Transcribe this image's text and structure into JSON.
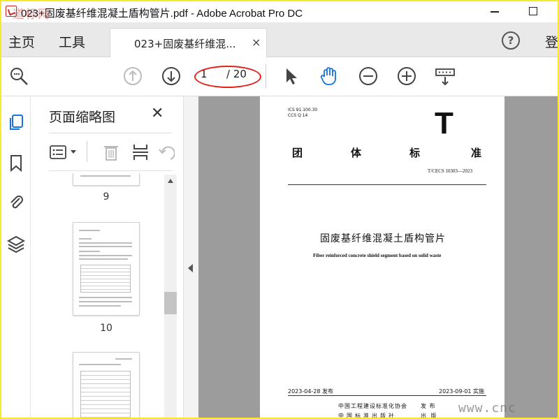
{
  "window": {
    "title": "023+固废基纤维混凝土盾构管片.pdf - Adobe Acrobat Pro DC",
    "watermark_top": "道标网"
  },
  "menu": {
    "home": "主页",
    "tools": "工具",
    "doc_tab": "023+固废基纤维混...",
    "close_tab": "×",
    "help": "?",
    "signin": "登"
  },
  "toolbar": {
    "current_page": "1",
    "page_total": "/ 20"
  },
  "thumbnail_panel": {
    "title": "页面缩略图",
    "close": "✕",
    "pages": [
      "9",
      "10"
    ]
  },
  "document": {
    "ics": "ICS 91.100.30",
    "ccs": "CCS Q 14",
    "big_letter": "T",
    "standard_type": [
      "团",
      "体",
      "标",
      "准"
    ],
    "code": "T/CECS 10303—2023",
    "title_cn": "固废基纤维混凝土盾构管片",
    "title_en": "Fiber reinforced concrete shield segment based on solid waste",
    "issue_date": "2023-04-28 发布",
    "impl_date": "2023-09-01 实施",
    "publisher1": "中国工程建设标准化协会",
    "publisher1_action": "发 布",
    "publisher2": "中国标准出版社",
    "publisher2_action": "出 版"
  },
  "watermark_bottom": "www.cnc",
  "colors": {
    "highlight": "#e0221b",
    "border": "#f7ea2a",
    "hand_tool": "#1473e6",
    "doc_bg": "#9c9c9c"
  }
}
